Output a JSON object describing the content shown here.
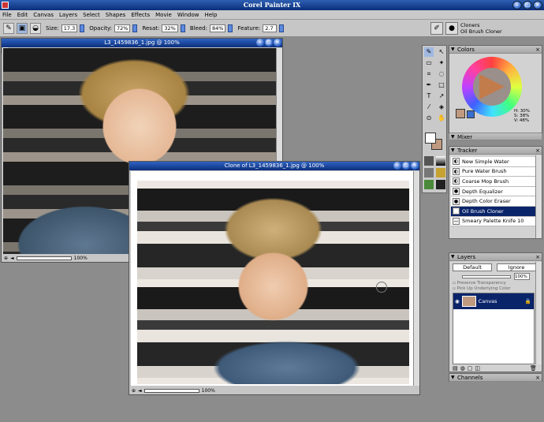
{
  "app": {
    "title": "Corel Painter IX"
  },
  "menu": [
    "File",
    "Edit",
    "Canvas",
    "Layers",
    "Select",
    "Shapes",
    "Effects",
    "Movie",
    "Window",
    "Help"
  ],
  "property_bar": {
    "size_label": "Size:",
    "size_value": "17.3",
    "opacity_label": "Opacity:",
    "opacity_value": "72%",
    "resat_label": "Resat:",
    "resat_value": "32%",
    "bleed_label": "Bleed:",
    "bleed_value": "84%",
    "feature_label": "Feature:",
    "feature_value": "2.7"
  },
  "brush_selector": {
    "category": "Cloners",
    "variant": "Oil Brush Cloner"
  },
  "source_window": {
    "title": "L3_1459836_1.jpg @ 100%",
    "zoom": "100%"
  },
  "clone_window": {
    "title": "Clone of L3_1459836_1.jpg @ 100%",
    "zoom": "100%"
  },
  "colors_panel": {
    "title": "Colors",
    "h": "H: 30%",
    "s": "S: 38%",
    "v": "V: 48%",
    "accent": "#c09a80"
  },
  "mixer_panel": {
    "title": "Mixer"
  },
  "tracker_panel": {
    "title": "Tracker",
    "items": [
      "New Simple Water",
      "Pure Water Brush",
      "Coarse Mop Brush",
      "Depth Equalizer",
      "Depth Color Eraser",
      "Oil Brush Cloner",
      "Smeary Palette Knife 10"
    ],
    "selected": "Oil Brush Cloner"
  },
  "layers_panel": {
    "title": "Layers",
    "composite_method": "Default",
    "composite_depth": "Ignore",
    "opacity": "100%",
    "preserve_transparency": "Preserve Transparency",
    "pick_up_underlying": "Pick Up Underlying Color",
    "layer_name": "Canvas"
  },
  "channels_panel": {
    "title": "Channels"
  }
}
